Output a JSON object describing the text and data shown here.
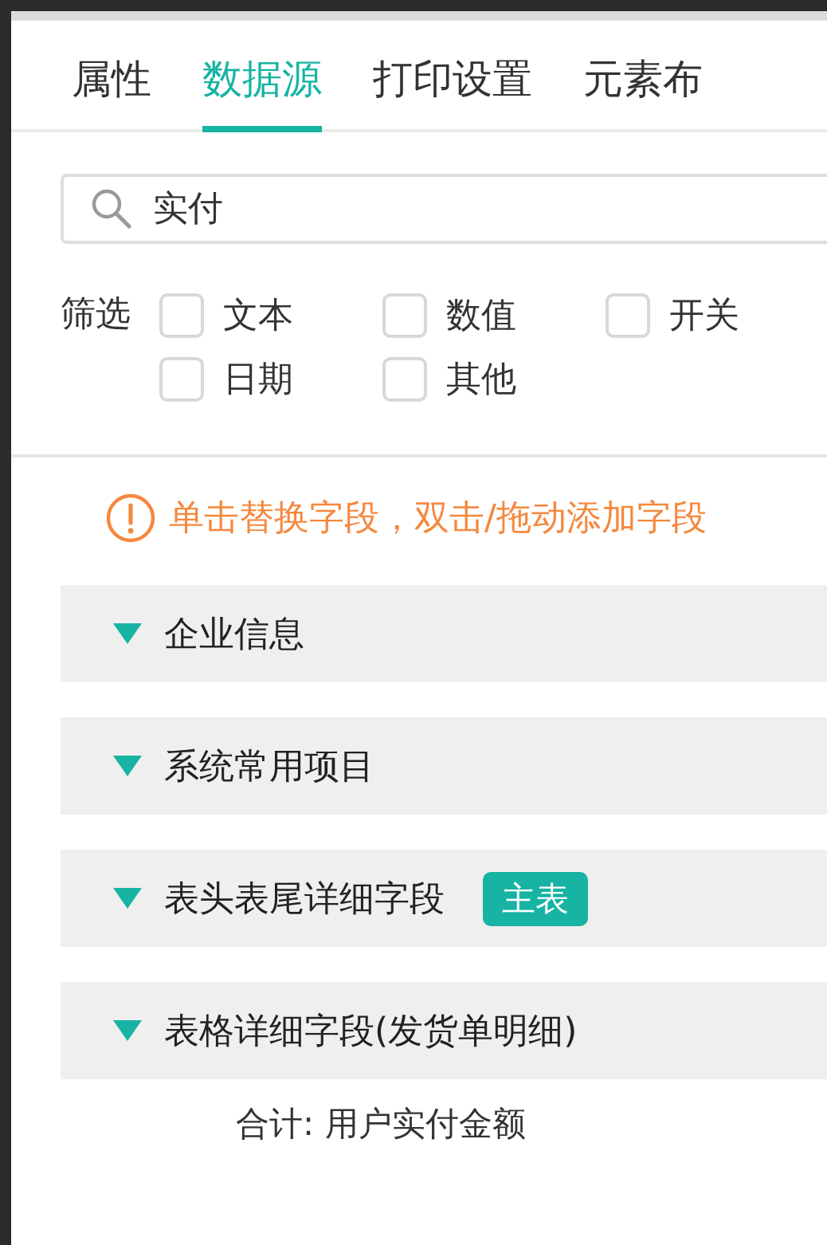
{
  "tabs": [
    {
      "label": "属性",
      "selected": false
    },
    {
      "label": "数据源",
      "selected": true
    },
    {
      "label": "打印设置",
      "selected": false
    },
    {
      "label": "元素布",
      "selected": false
    }
  ],
  "search": {
    "value": "实付"
  },
  "filter": {
    "label": "筛选",
    "options": [
      {
        "label": "文本",
        "checked": false
      },
      {
        "label": "数值",
        "checked": false
      },
      {
        "label": "开关",
        "checked": false
      },
      {
        "label": "日期",
        "checked": false
      },
      {
        "label": "其他",
        "checked": false
      }
    ]
  },
  "notice": "单击替换字段，双击/拖动添加字段",
  "groups": [
    {
      "title": "企业信息",
      "expanded": true
    },
    {
      "title": "系统常用项目",
      "expanded": true
    },
    {
      "title": "表头表尾详细字段",
      "expanded": true,
      "badge": "主表"
    },
    {
      "title": "表格详细字段(发货单明细)",
      "expanded": true,
      "items": [
        "合计: 用户实付金额"
      ]
    }
  ]
}
